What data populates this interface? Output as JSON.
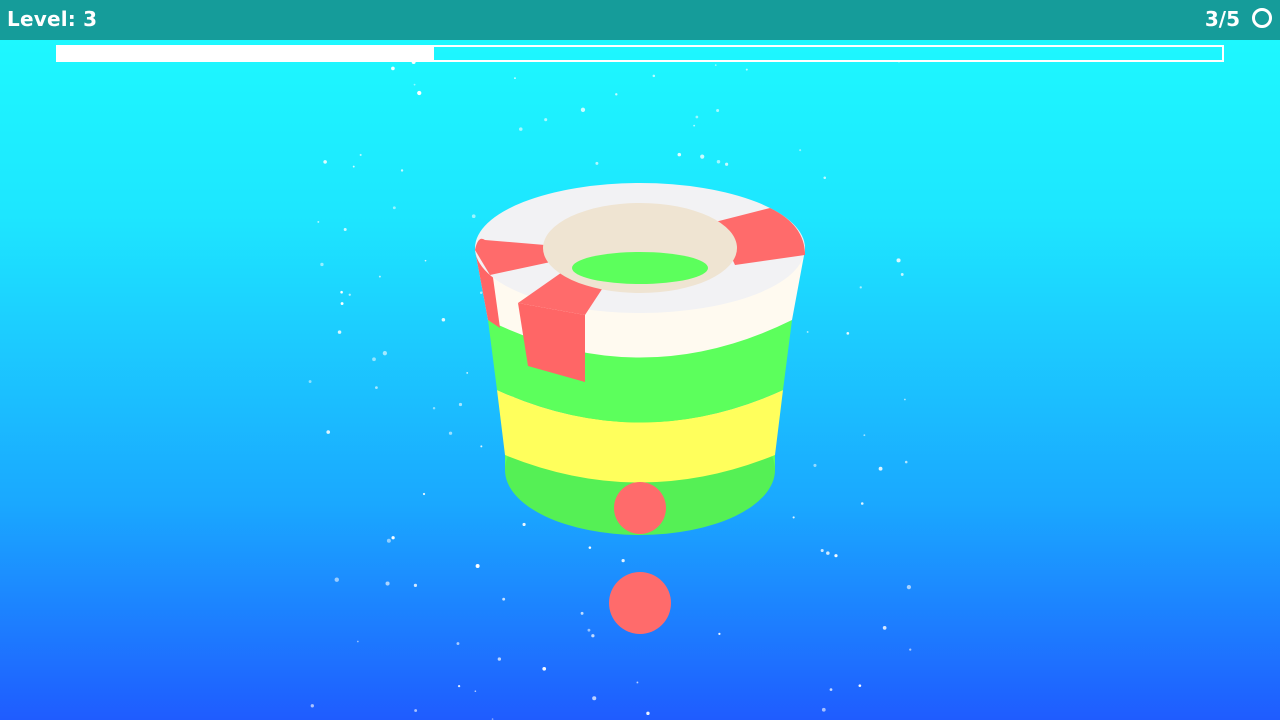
{
  "hud": {
    "level_label": "Level: 3",
    "balls_label": "3/5",
    "progress_fraction": 0.323,
    "ring_icon": "ring-icon"
  },
  "scene": {
    "colors": {
      "green": "#5cff5c",
      "yellow": "#ffff5c",
      "white": "#fffaf2",
      "red": "#ff6b6b",
      "inner": "#efe6d6"
    },
    "tower_layers": [
      "green",
      "yellow",
      "green"
    ],
    "top_ring": [
      "white",
      "red"
    ],
    "balls": 2
  }
}
